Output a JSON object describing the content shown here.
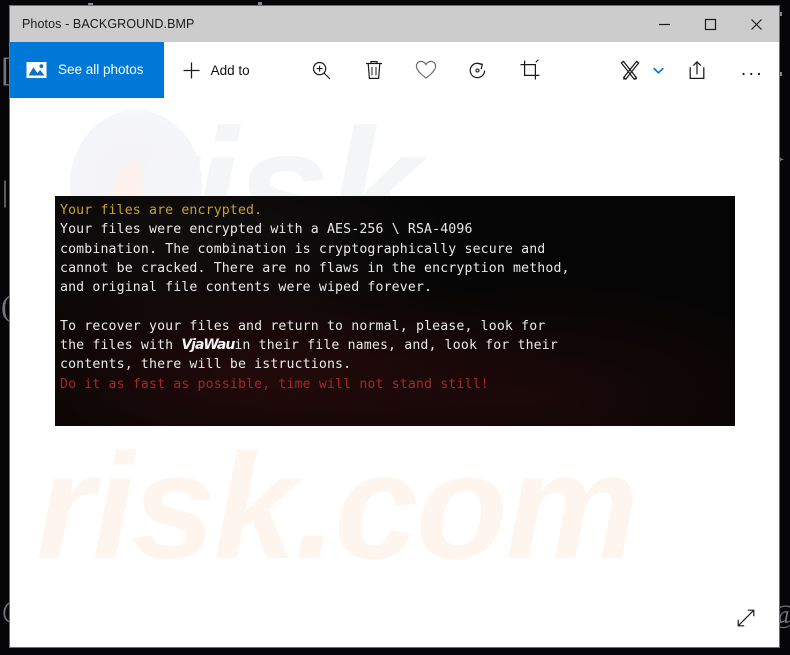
{
  "window": {
    "title": "Photos - BACKGROUND.BMP",
    "controls": {
      "minimize_label": "Minimize",
      "maximize_label": "Maximize",
      "close_label": "Close"
    }
  },
  "toolbar": {
    "see_all_photos_label": "See all photos",
    "see_all_photos_icon": "photo-mountain-icon",
    "add_to_label": "Add to",
    "add_to_icon": "plus-icon",
    "zoom_icon": "magnifier-plus-icon",
    "delete_icon": "trash-icon",
    "favorite_icon": "heart-icon",
    "rotate_icon": "rotate-icon",
    "crop_icon": "crop-icon",
    "draw_icon": "pen-pencil-icon",
    "draw_chevron_icon": "chevron-down-icon",
    "share_icon": "share-icon",
    "more_icon": "ellipsis-icon",
    "more_label": "..."
  },
  "viewer": {
    "fullscreen_icon": "diagonal-arrows-expand-icon",
    "watermark_top": "risk",
    "watermark_bottom": "risk.com"
  },
  "note": {
    "accent_gold": "#c9a227",
    "accent_white": "#e9e9ea",
    "accent_red": "#a3272c",
    "line_heading": "Your files are encrypted.",
    "line_2": "Your files were encrypted with a AES-256 \\ RSA-4096",
    "line_3": "combination. The combination is cryptographically secure and",
    "line_4": "cannot be cracked. There are no flaws in the encryption method,",
    "line_5": "and original file contents were wiped forever.",
    "line_blank": "",
    "line_6": "To recover your files and return to normal, please, look for",
    "line_7a": "the files with ",
    "line_7_handwritten": "VjaWau",
    "line_7b": "in their file names, and, look for their",
    "line_8": "contents, there will be istructions.",
    "line_9": "Do it as fast as possible, time will not stand still!"
  },
  "desktop": {
    "glyph_1": "[",
    "glyph_2": "|",
    "glyph_3": "(",
    "glyph_4": "@",
    "glyph_5": "}",
    "glyph_6": "@"
  }
}
